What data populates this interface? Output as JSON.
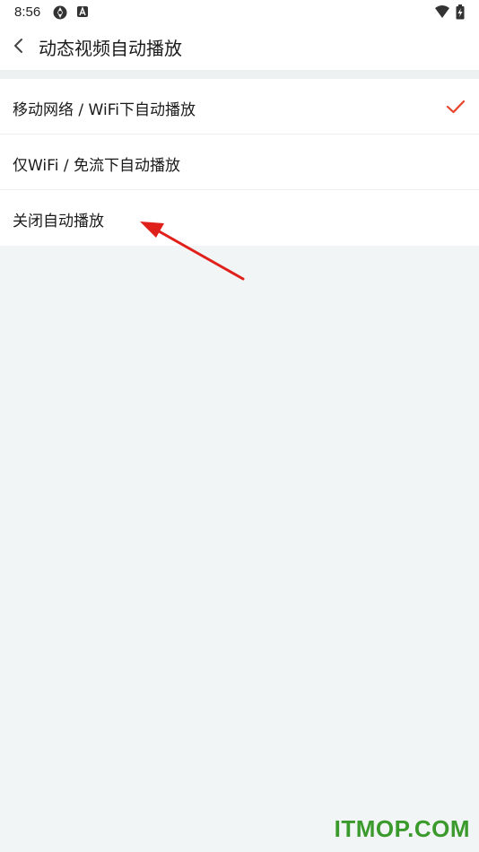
{
  "status_bar": {
    "time": "8:56",
    "icons": [
      "sync-icon",
      "a-notification-icon",
      "wifi-icon",
      "battery-charging-icon"
    ]
  },
  "header": {
    "back_icon": "chevron-left-icon",
    "title": "动态视频自动播放"
  },
  "options": [
    {
      "label": "移动网络 / WiFi下自动播放",
      "selected": true
    },
    {
      "label": "仅WiFi / 免流下自动播放",
      "selected": false
    },
    {
      "label": "关闭自动播放",
      "selected": false
    }
  ],
  "accent_color": "#e8442c",
  "annotation": {
    "type": "red-arrow",
    "color": "#e0201b"
  },
  "watermark": "ITMOP.COM"
}
